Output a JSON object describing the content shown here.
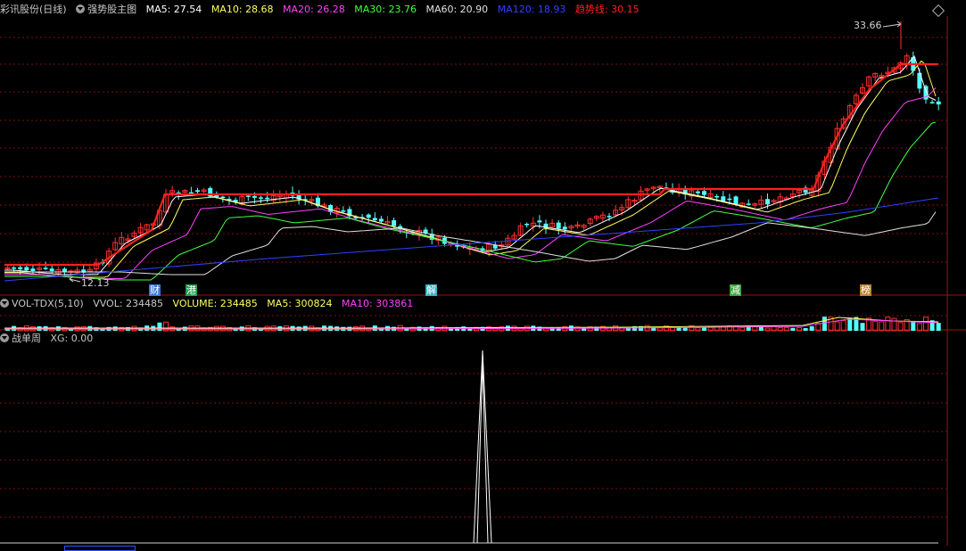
{
  "main_header": {
    "stock": "彩讯股份(日线)",
    "indicator": "强势股主图",
    "ma5": "MA5: 27.54",
    "ma10": "MA10: 28.68",
    "ma20": "MA20: 26.28",
    "ma30": "MA30: 23.76",
    "ma60": "MA60: 20.90",
    "ma120": "MA120: 18.93",
    "trend": "趋势线: 30.15"
  },
  "vol_header": {
    "name": "VOL-TDX(5,10)",
    "vvol": "VVOL: 234485",
    "volume": "VOLUME: 234485",
    "ma5": "MA5: 300824",
    "ma10": "MA10: 303861"
  },
  "sub_header": {
    "name": "战单周",
    "xg": "XG: 0.00"
  },
  "price_labels": {
    "high": "33.66",
    "low": "12.13"
  },
  "markers": [
    {
      "text": "财",
      "color": "#3a78d8"
    },
    {
      "text": "港",
      "color": "#1fa050"
    },
    {
      "text": "解",
      "color": "#3ab0c0"
    },
    {
      "text": "减",
      "color": "#40a040"
    },
    {
      "text": "榜",
      "color": "#c08030"
    }
  ],
  "colors": {
    "up": "#ff3030",
    "down": "#54ffff",
    "ma5": "#ffff60",
    "ma10": "#ffff60",
    "ma20": "#ff40ff",
    "ma30": "#40ff40",
    "ma60": "#e0e0e0",
    "ma120": "#3040ff",
    "trend": "#ff2020"
  }
}
